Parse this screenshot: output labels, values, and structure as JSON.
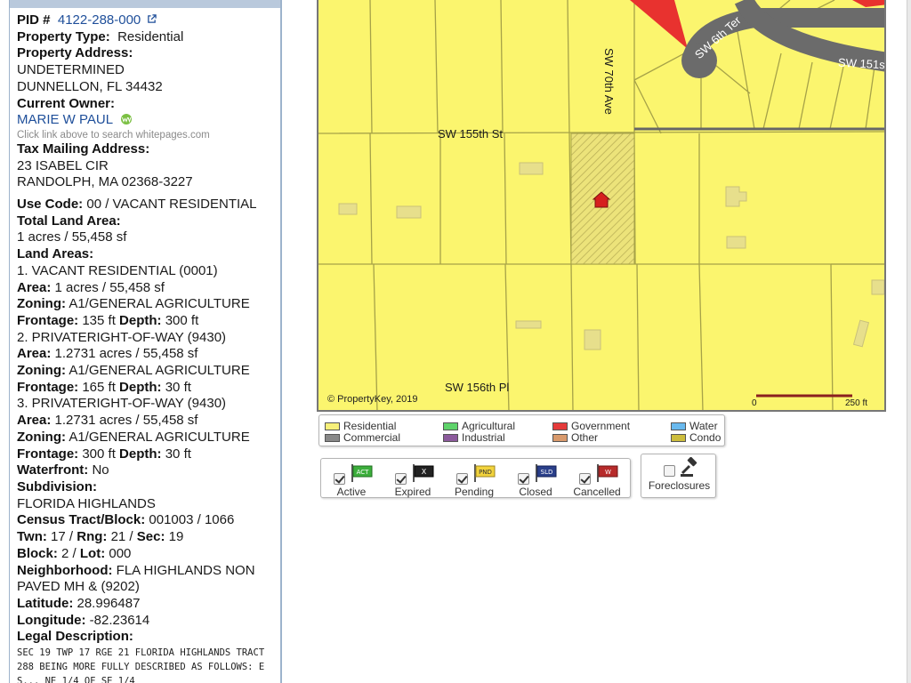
{
  "panel": {
    "pid_label": "PID #",
    "pid_value": "4122-288-000",
    "property_type_label": "Property Type:",
    "property_type_value": "Residential",
    "property_address_label": "Property Address:",
    "property_address_line1": "UNDETERMINED",
    "property_address_line2": "DUNNELLON, FL 34432",
    "current_owner_label": "Current Owner:",
    "owner_name": "MARIE W PAUL",
    "whitepages_hint": "Click link above to search whitepages.com",
    "tax_mailing_label": "Tax Mailing Address:",
    "tax_mailing_line1": "23 ISABEL CIR",
    "tax_mailing_line2": "RANDOLPH, MA 02368-3227",
    "use_code_label": "Use Code:",
    "use_code_value": "00 / VACANT RESIDENTIAL",
    "total_land_area_label": "Total Land Area:",
    "total_land_area_value": "1 acres / 55,458 sf",
    "land_areas_label": "Land Areas:",
    "land_areas": [
      {
        "title": "1. VACANT RESIDENTIAL (0001)",
        "area": "1 acres / 55,458 sf",
        "zoning": "A1/GENERAL AGRICULTURE",
        "frontage": "135 ft",
        "depth": "300 ft"
      },
      {
        "title": "2. PRIVATERIGHT-OF-WAY (9430)",
        "area": "1.2731 acres / 55,458 sf",
        "zoning": "A1/GENERAL AGRICULTURE",
        "frontage": "165 ft",
        "depth": "30 ft"
      },
      {
        "title": "3. PRIVATERIGHT-OF-WAY (9430)",
        "area": "1.2731 acres / 55,458 sf",
        "zoning": "A1/GENERAL AGRICULTURE",
        "frontage": "300 ft",
        "depth": "30 ft"
      }
    ],
    "area_label": "Area:",
    "zoning_label": "Zoning:",
    "frontage_label": "Frontage:",
    "depth_label": "Depth:",
    "waterfront_label": "Waterfront:",
    "waterfront_value": "No",
    "subdivision_label": "Subdivision:",
    "subdivision_value": "FLORIDA HIGHLANDS",
    "census_label": "Census Tract/Block:",
    "census_value": "001003 / 1066",
    "twn_label": "Twn:",
    "twn_value": "17",
    "rng_label": "Rng:",
    "rng_value": "21",
    "sec_label": "Sec:",
    "sec_value": "19",
    "block_label": "Block:",
    "block_value": "2",
    "lot_label": "Lot:",
    "lot_value": "000",
    "neighborhood_label": "Neighborhood:",
    "neighborhood_line1": "FLA HIGHLANDS NON",
    "neighborhood_line2": "PAVED MH & (9202)",
    "latitude_label": "Latitude:",
    "latitude_value": "28.996487",
    "longitude_label": "Longitude:",
    "longitude_value": "-82.23614",
    "legal_label": "Legal Description:",
    "legal_line1": "SEC 19 TWP 17 RGE 21 FLORIDA HIGHLANDS TRACT",
    "legal_line2": "288 BEING MORE FULLY DESCRIBED AS FOLLOWS: E",
    "legal_line3": "S... NE 1/4 OF SE 1/4"
  },
  "map": {
    "streets": {
      "sw_70th_ave": "SW 70th Ave",
      "sw_155th_st": "SW 155th St",
      "sw_156th_pl": "SW 156th Pl",
      "sw_6th_ter": "SW 6th Ter",
      "sw_151": "SW 151s"
    },
    "copyright": "© PropertyKey, 2019",
    "scale_start": "0",
    "scale_end": "250 ft",
    "colors": {
      "residential": "#fbf56e",
      "road": "#6b6b6b",
      "government": "#e8322f",
      "parcel_line": "#a6a248"
    }
  },
  "legend": {
    "items": [
      {
        "label": "Residential",
        "color": "#f7f07a"
      },
      {
        "label": "Commercial",
        "color": "#888888"
      },
      {
        "label": "Agricultural",
        "color": "#5ed36a"
      },
      {
        "label": "Industrial",
        "color": "#8c5a9c"
      },
      {
        "label": "Government",
        "color": "#e53b3b"
      },
      {
        "label": "Other",
        "color": "#d99a6c"
      },
      {
        "label": "Water",
        "color": "#69b9ee"
      },
      {
        "label": "Condo",
        "color": "#cdbd3d"
      }
    ]
  },
  "filters": [
    {
      "label": "Active",
      "flag_text": "ACT",
      "flag_color": "#3cae3c",
      "text_color": "#ffffff"
    },
    {
      "label": "Expired",
      "flag_text": "X",
      "flag_color": "#222222",
      "text_color": "#ffffff"
    },
    {
      "label": "Pending",
      "flag_text": "PND",
      "flag_color": "#f2d33c",
      "text_color": "#333333"
    },
    {
      "label": "Closed",
      "flag_text": "SLD",
      "flag_color": "#2a3f8a",
      "text_color": "#ffffff"
    },
    {
      "label": "Cancelled",
      "flag_text": "W",
      "flag_color": "#b72a2a",
      "text_color": "#ffffff"
    }
  ],
  "foreclosures": {
    "label": "Foreclosures"
  }
}
